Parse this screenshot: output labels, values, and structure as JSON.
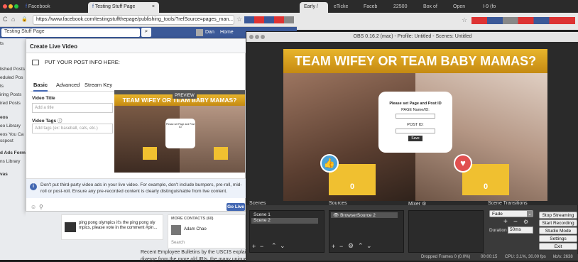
{
  "browser1": {
    "tabs": [
      "Facebook",
      "Testing Stuff Page"
    ],
    "url": "https://www.facebook.com/testingstuffthepage/publishing_tools/?refSource=pages_man...",
    "fb_search_text": "Testing Stuff Page",
    "fb_user": "Dan",
    "fb_home": "Home",
    "left_nav": [
      "ts",
      "lished Posts",
      "eduled Pos",
      "ts",
      "iring Posts",
      "ired Posts",
      "eos",
      "eo Library",
      "eos You Ca",
      "sspost",
      "d Ads Form",
      "ns Library",
      "vas"
    ]
  },
  "modal": {
    "title": "Create Live Video",
    "post_info": "PUT YOUR POST INFO HERE:",
    "tabs": [
      "Basic",
      "Advanced",
      "Stream Key"
    ],
    "video_title_label": "Video Title",
    "video_title_placeholder": "Add a title",
    "video_tags_label": "Video Tags",
    "video_tags_placeholder": "Add tags (ex: baseball, cats, etc.)",
    "preview_badge": "PREVIEW",
    "notice": "Don't put third-party video ads in your live video. For example, don't include bumpers, pre-roll, mid-roll or post-roll. Ensure any pre-recorded content is clearly distinguishable from live content.",
    "go_live": "Go Live"
  },
  "feed": {
    "post_text": "ping pong olympics it's the ping pong oly mpics, please vote in the comment #pin...",
    "more_contacts": "MORE CONTACTS (60)",
    "contact": "Adam Chao",
    "search": "Search",
    "bulletin": "Recent Employee Bulletins by the USCIS explain many",
    "bulletin2": "diverge from the more old IRIs, the many unique forms"
  },
  "browser2": {
    "tabs": [
      "Early /",
      "eTicke",
      "Faceb",
      "22500",
      "Box of",
      "Open",
      "I-9 (fo"
    ]
  },
  "obs": {
    "title": "OBS 0.16.2 (mac) - Profile: Untitled - Scenes: Untitled",
    "banner": "TEAM WIFEY OR TEAM BABY MAMAS?",
    "form_title": "Please set Page and Post ID",
    "page_label": "PAGE Name/ID:",
    "post_label": "POST ID:",
    "save": "Save",
    "vote_left": "0",
    "vote_right": "0",
    "scenes_label": "Scenes",
    "scenes": [
      "Scene 1",
      "Scene 2"
    ],
    "sources_label": "Sources",
    "sources": [
      "BrowserSource 2"
    ],
    "mixer_label": "Mixer",
    "transitions_label": "Scene Transitions",
    "transition": "Fade",
    "duration_label": "Duration",
    "duration": "50ms",
    "buttons": [
      "Stop Streaming",
      "Start Recording",
      "Studio Mode",
      "Settings",
      "Exit"
    ],
    "status": {
      "dropped": "Dropped Frames 0 (0.0%)",
      "time": "00:00:15",
      "cpu": "CPU: 3.1%, 30.00 fps",
      "kbps": "kb/s: 2638"
    }
  }
}
